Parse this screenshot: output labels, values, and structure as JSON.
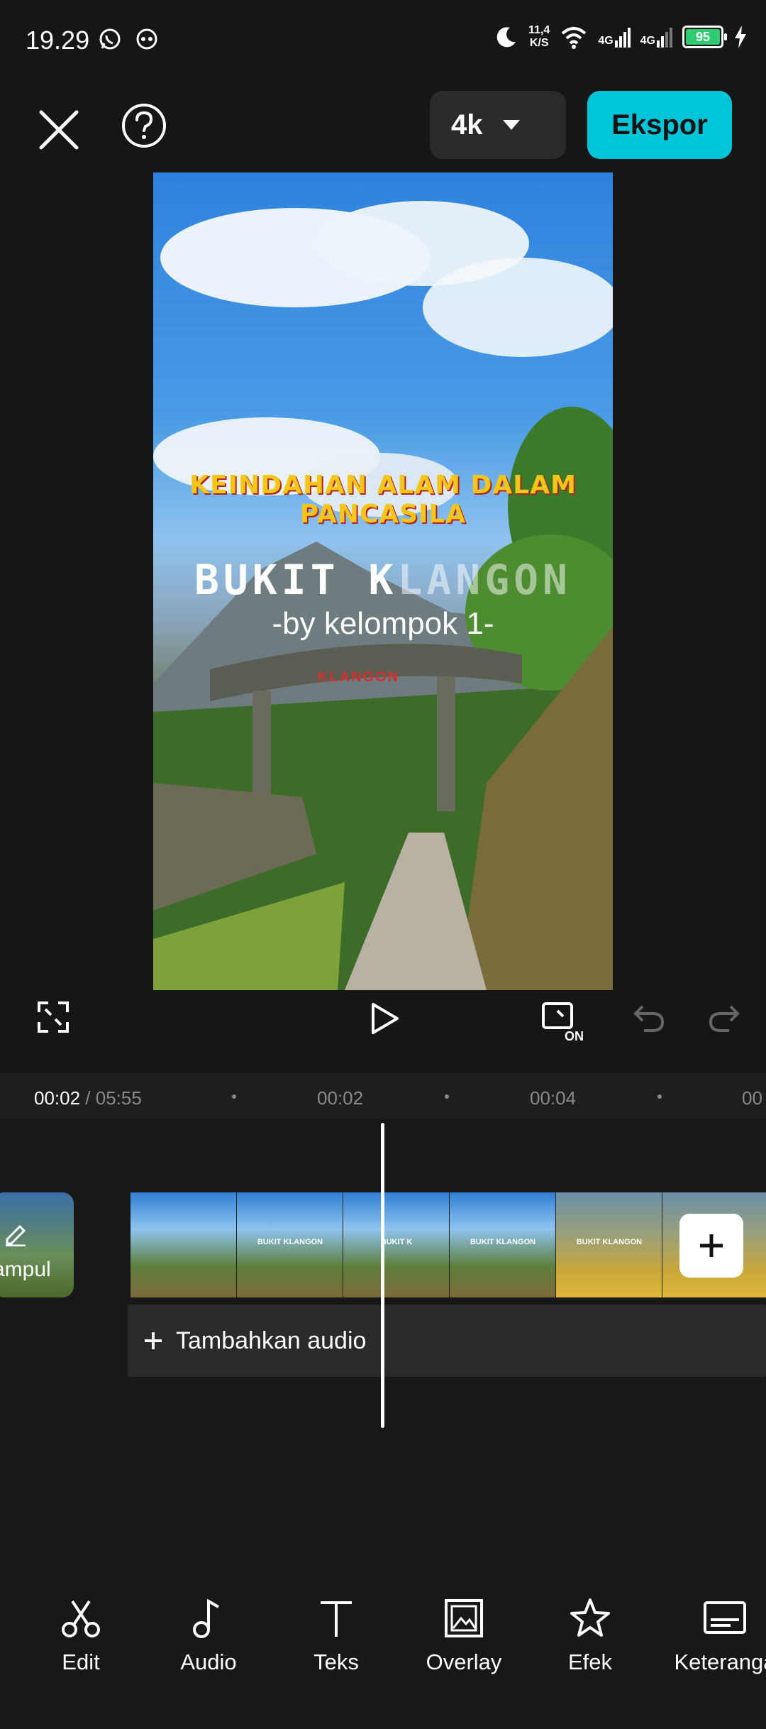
{
  "status_bar": {
    "time": "19.29",
    "net_speed_value": "11,4",
    "net_speed_unit": "K/S",
    "signal_1": "4G",
    "signal_2": "4G",
    "battery": "95"
  },
  "toolbar": {
    "resolution": "4k",
    "export_label": "Ekspor"
  },
  "preview": {
    "title_text": "KEINDAHAN ALAM DALAM PANCASILA",
    "main_text_solid": "BUKIT K",
    "main_text_faded": "LANGON",
    "sub_text": "-by kelompok 1-",
    "bridge_text": "KLANGON"
  },
  "timeline": {
    "current_time": "00:02",
    "total_time": " / 05:55",
    "ticks": [
      "00:02",
      "00:04",
      "00"
    ]
  },
  "tracks": {
    "cover_label": "ampul",
    "frames": [
      {
        "text": "",
        "style": "blue"
      },
      {
        "text": "BUKIT KLANGON",
        "style": "blue"
      },
      {
        "text": "BUKIT K",
        "style": "blue"
      },
      {
        "text": "BUKIT KLANGON",
        "style": "blue"
      },
      {
        "text": "BUKIT KLANGON",
        "style": "gold"
      },
      {
        "text": "",
        "style": "gold"
      }
    ],
    "add_audio_label": "Tambahkan audio"
  },
  "bottom_tools": [
    {
      "label": "Edit",
      "icon": "scissors-icon"
    },
    {
      "label": "Audio",
      "icon": "music-note-icon"
    },
    {
      "label": "Teks",
      "icon": "text-icon"
    },
    {
      "label": "Overlay",
      "icon": "overlay-icon"
    },
    {
      "label": "Efek",
      "icon": "star-effect-icon"
    },
    {
      "label": "Keteranga",
      "icon": "captions-icon"
    }
  ],
  "colors": {
    "accent": "#00c4d8",
    "background": "#161616",
    "battery": "#2ecc71"
  }
}
